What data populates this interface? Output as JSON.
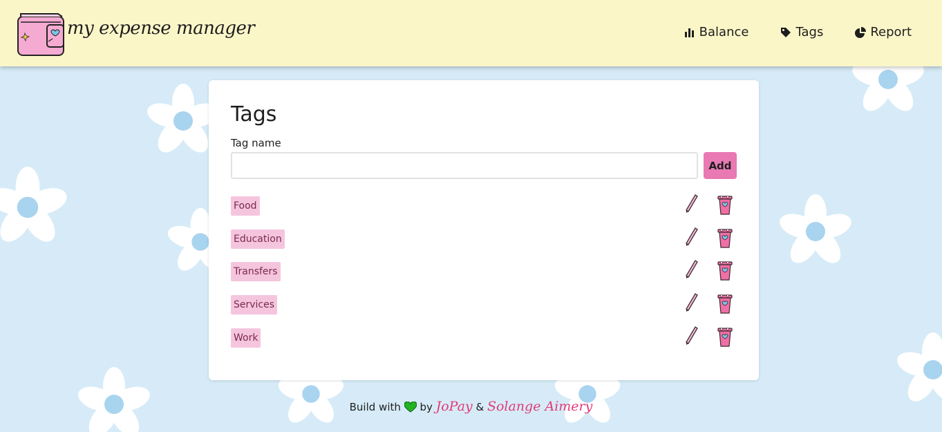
{
  "app": {
    "brand": "my expense manager"
  },
  "nav": [
    {
      "label": "Balance",
      "icon": "bar-chart-icon"
    },
    {
      "label": "Tags",
      "icon": "tag-icon"
    },
    {
      "label": "Report",
      "icon": "pie-chart-icon"
    }
  ],
  "page": {
    "title": "Tags",
    "form": {
      "label": "Tag name",
      "value": "",
      "placeholder": "",
      "add_label": "Add"
    },
    "tags": [
      {
        "name": "Food"
      },
      {
        "name": "Education"
      },
      {
        "name": "Transfers"
      },
      {
        "name": "Services"
      },
      {
        "name": "Work"
      }
    ]
  },
  "footer": {
    "prefix": "Build with",
    "by": "by",
    "author1": "JoPay",
    "amp": "&",
    "author2": "Solange Aimery"
  },
  "colors": {
    "header_bg": "#fbf6c8",
    "page_bg": "#d6ebf7",
    "accent_pink": "#e879b3",
    "tag_bg": "#f5c5de",
    "heart": "#22b422"
  }
}
